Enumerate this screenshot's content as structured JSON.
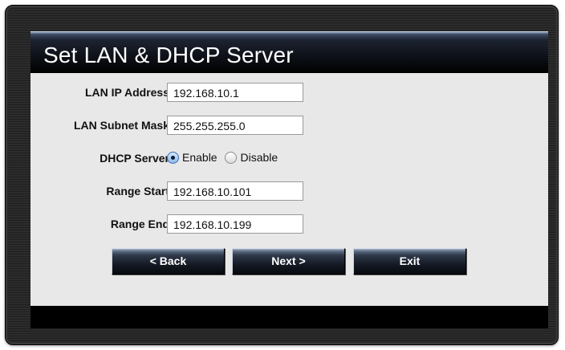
{
  "window": {
    "title": "Set LAN & DHCP Server"
  },
  "form": {
    "lan_ip": {
      "label": "LAN IP Address",
      "value": "192.168.10.1"
    },
    "subnet": {
      "label": "LAN Subnet Mask",
      "value": "255.255.255.0"
    },
    "dhcp": {
      "label": "DHCP Server",
      "enable_label": "Enable",
      "disable_label": "Disable",
      "selected": "Enable"
    },
    "range_start": {
      "label": "Range Start",
      "value": "192.168.10.101"
    },
    "range_end": {
      "label": "Range End",
      "value": "192.168.10.199"
    }
  },
  "buttons": {
    "back": "< Back",
    "next": "Next >",
    "exit": "Exit"
  }
}
